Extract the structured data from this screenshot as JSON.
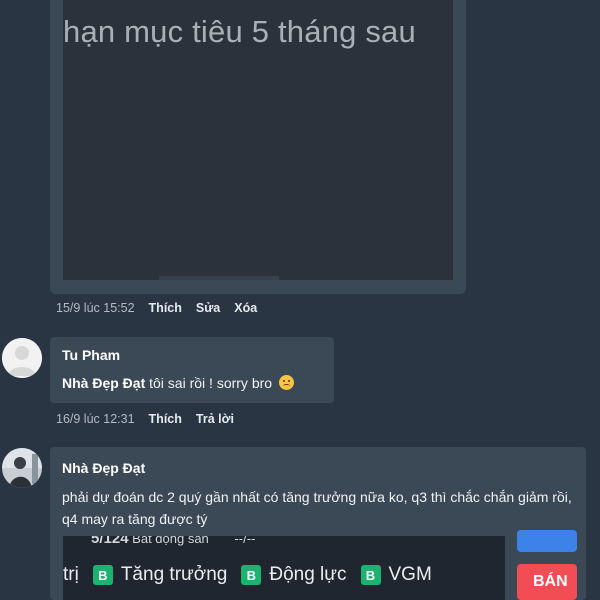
{
  "post_image": {
    "text": "hạn mục tiêu 5 tháng sau"
  },
  "post_meta": {
    "time": "15/9 lúc 15:52",
    "like": "Thích",
    "edit": "Sửa",
    "delete": "Xóa"
  },
  "comment1": {
    "author": "Tu Pham",
    "mention": "Nhà Đẹp Đạt",
    "text": "tôi sai rồi ! sorry bro",
    "emoji": "disappointed-face-icon",
    "time": "16/9 lúc 12:31",
    "like": "Thích",
    "reply": "Trả lời"
  },
  "comment2": {
    "author": "Nhà Đẹp Đạt",
    "text": "phải dự đoán dc 2 quý gần nhất có tăng trưởng nữa ko, q3 thì chắc chắn giảm rồi, q4 may ra tăng được tý",
    "image": {
      "top_num": "5/124",
      "top_label": "Bất động sản",
      "top_dash": "--/--",
      "prefix": "trị",
      "tags": [
        {
          "badge": "B",
          "label": "Tăng trưởng"
        },
        {
          "badge": "B",
          "label": "Động lực"
        },
        {
          "badge": "B",
          "label": "VGM"
        }
      ],
      "sell_button": "BÁN"
    }
  },
  "colors": {
    "background": "#293542",
    "bubble": "#3b4856",
    "tag_green": "#1bb36f",
    "sell_red": "#f24c55",
    "buy_blue": "#3d82e8"
  }
}
